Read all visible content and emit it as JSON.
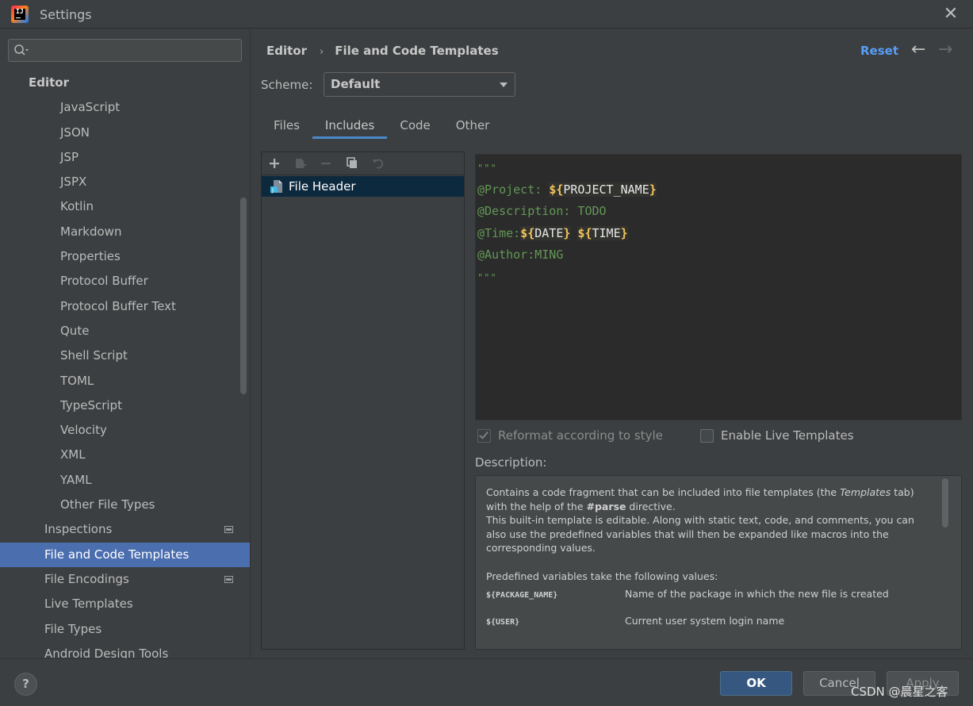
{
  "window": {
    "title": "Settings"
  },
  "search": {
    "value": "",
    "placeholder": ""
  },
  "sidebar": {
    "items": [
      {
        "label": "Editor",
        "level": 0
      },
      {
        "label": "JavaScript",
        "level": 2
      },
      {
        "label": "JSON",
        "level": 2
      },
      {
        "label": "JSP",
        "level": 2
      },
      {
        "label": "JSPX",
        "level": 2
      },
      {
        "label": "Kotlin",
        "level": 2
      },
      {
        "label": "Markdown",
        "level": 2
      },
      {
        "label": "Properties",
        "level": 2
      },
      {
        "label": "Protocol Buffer",
        "level": 2
      },
      {
        "label": "Protocol Buffer Text",
        "level": 2
      },
      {
        "label": "Qute",
        "level": 2
      },
      {
        "label": "Shell Script",
        "level": 2
      },
      {
        "label": "TOML",
        "level": 2
      },
      {
        "label": "TypeScript",
        "level": 2
      },
      {
        "label": "Velocity",
        "level": 2
      },
      {
        "label": "XML",
        "level": 2
      },
      {
        "label": "YAML",
        "level": 2
      },
      {
        "label": "Other File Types",
        "level": 2
      },
      {
        "label": "Inspections",
        "level": 1,
        "badge": true
      },
      {
        "label": "File and Code Templates",
        "level": 1,
        "selected": true
      },
      {
        "label": "File Encodings",
        "level": 1,
        "badge": true
      },
      {
        "label": "Live Templates",
        "level": 1
      },
      {
        "label": "File Types",
        "level": 1
      },
      {
        "label": "Android Design Tools",
        "level": 1
      }
    ]
  },
  "header": {
    "breadcrumb_parent": "Editor",
    "breadcrumb_separator": "›",
    "breadcrumb_current": "File and Code Templates",
    "reset_label": "Reset",
    "back_icon": "←",
    "forward_icon": "→"
  },
  "scheme": {
    "label": "Scheme:",
    "value": "Default"
  },
  "tabs": [
    {
      "label": "Files",
      "active": false
    },
    {
      "label": "Includes",
      "active": true
    },
    {
      "label": "Code",
      "active": false
    },
    {
      "label": "Other",
      "active": false
    }
  ],
  "template_list": {
    "items": [
      {
        "label": "File Header",
        "selected": true
      }
    ]
  },
  "editor": {
    "quote_open": "\"\"\"",
    "project_key": "@Project: ",
    "project_var": "PROJECT_NAME",
    "description_line": "@Description: TODO",
    "time_key": "@Time:",
    "date_var": "DATE",
    "time_var": "TIME",
    "author_line": "@Author:MING",
    "quote_close": "\"\"\"",
    "var_open": "${",
    "var_close": "}",
    "var_space": " "
  },
  "options": {
    "reformat_label": "Reformat according to style",
    "reformat_checked": true,
    "reformat_disabled": true,
    "live_templates_label": "Enable Live Templates",
    "live_templates_checked": false
  },
  "description": {
    "label": "Description:",
    "p1_a": "Contains a code fragment that can be included into file templates (the ",
    "p1_templates": "Templates",
    "p1_b": " tab) with the help of the ",
    "p1_parse": "#parse",
    "p1_c": " directive.",
    "p2": "This built-in template is editable. Along with static text, code, and comments, you can also use the predefined variables that will then be expanded like macros into the corresponding values.",
    "p3": "Predefined variables take the following values:",
    "variables": [
      {
        "name": "${PACKAGE_NAME}",
        "desc": "Name of the package in which the new file is created"
      },
      {
        "name": "${USER}",
        "desc": "Current user system login name"
      }
    ]
  },
  "buttons": {
    "help": "?",
    "ok": "OK",
    "cancel": "Cancel",
    "apply": "Apply"
  },
  "watermark": "CSDN @晨星之客",
  "colors": {
    "accent": "#4b6eaf",
    "link": "#589df6",
    "ok_button": "#365880",
    "editor_bg": "#2b2b2b",
    "template_var_brace": "#f2c55c",
    "template_text": "#629755"
  }
}
